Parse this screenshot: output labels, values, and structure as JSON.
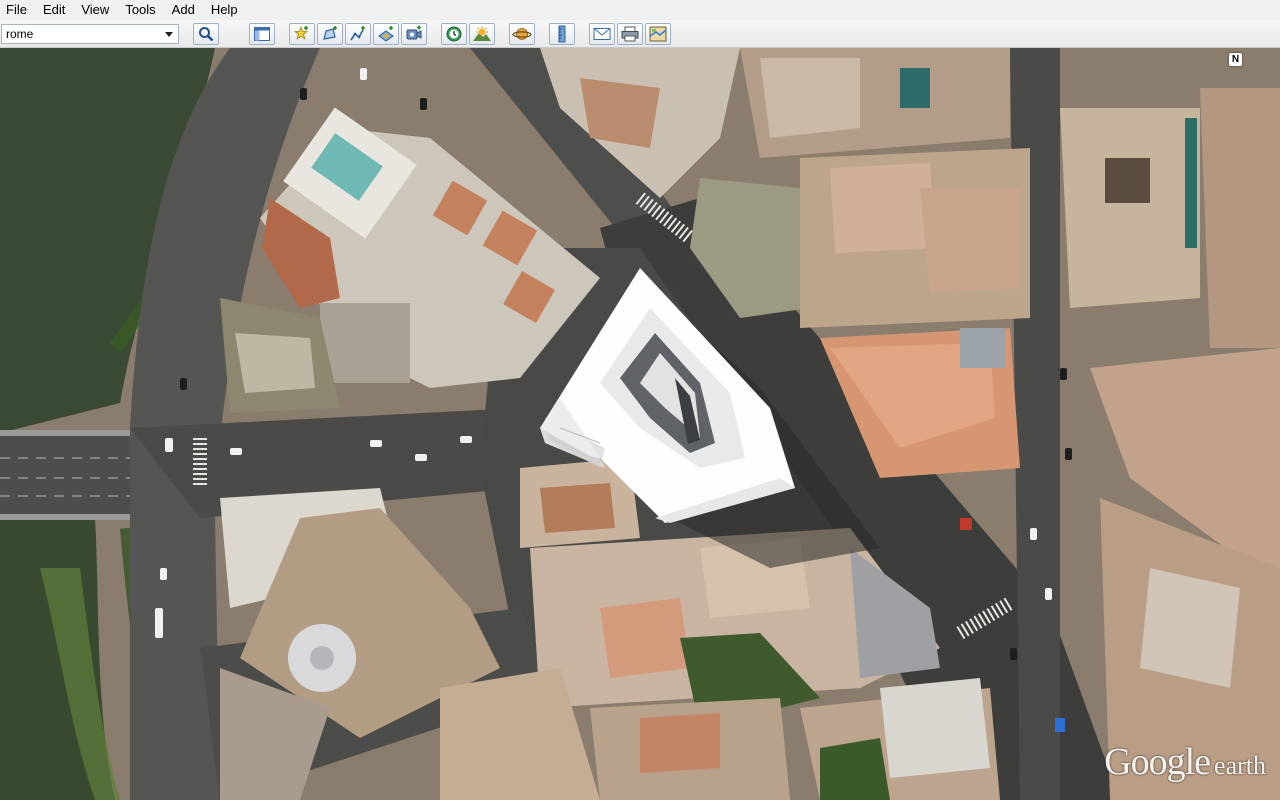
{
  "menubar": {
    "items": [
      {
        "label": "File"
      },
      {
        "label": "Edit"
      },
      {
        "label": "View"
      },
      {
        "label": "Tools"
      },
      {
        "label": "Add"
      },
      {
        "label": "Help"
      }
    ]
  },
  "search": {
    "value": "rome",
    "button_icon": "search-icon"
  },
  "toolbar": {
    "buttons": [
      {
        "icon": "sidebar-icon"
      },
      {
        "icon": "add-placemark-icon"
      },
      {
        "icon": "add-polygon-icon"
      },
      {
        "icon": "add-path-icon"
      },
      {
        "icon": "add-image-overlay-icon"
      },
      {
        "icon": "record-tour-icon"
      },
      {
        "icon": "sunlight-icon"
      },
      {
        "icon": "planets-icon"
      },
      {
        "icon": "ruler-icon"
      },
      {
        "icon": "email-icon"
      },
      {
        "icon": "print-icon"
      },
      {
        "icon": "view-in-maps-icon"
      }
    ]
  },
  "map": {
    "compass_label": "N",
    "logo_brand": "Google",
    "logo_product": "earth"
  },
  "colors": {
    "river": "#3b4a34",
    "road": "#5a5a58",
    "roof": "#c29a7f",
    "model": "#ffffff"
  }
}
